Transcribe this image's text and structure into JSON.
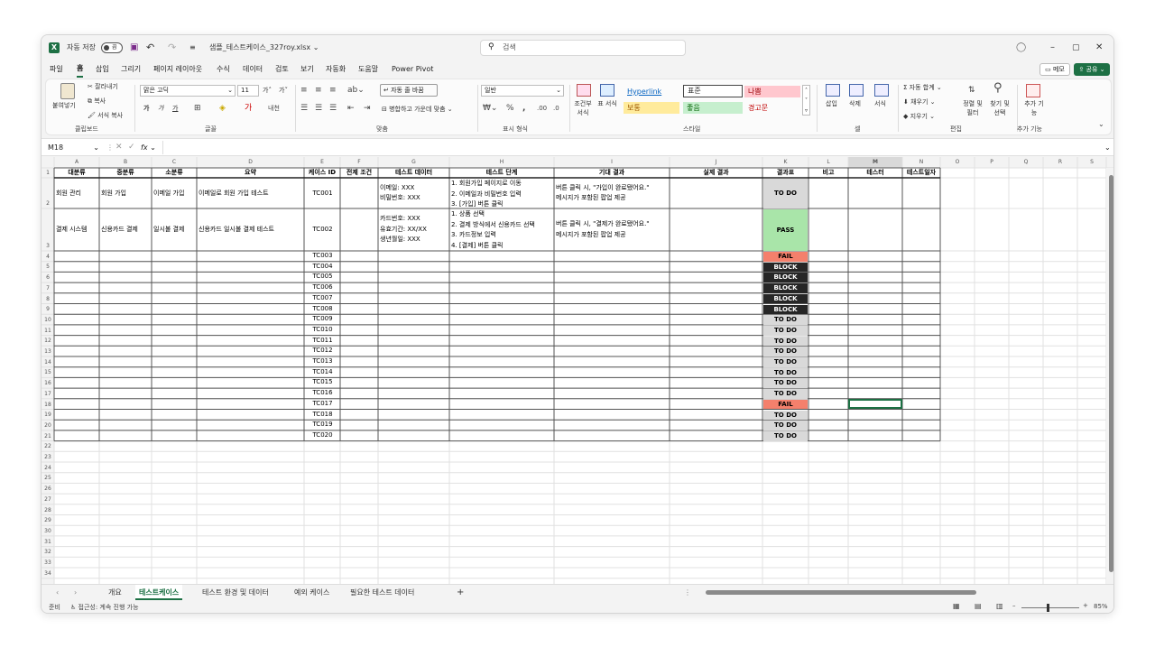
{
  "titlebar": {
    "autosave_label": "자동 저장",
    "autosave_state": "끔",
    "filename": "샘플_테스트케이스_327roy.xlsx",
    "search_placeholder": "검색"
  },
  "menu": [
    "파일",
    "홈",
    "삽입",
    "그리기",
    "페이지 레이아웃",
    "수식",
    "데이터",
    "검토",
    "보기",
    "자동화",
    "도움말",
    "Power Pivot"
  ],
  "menu_right": {
    "memo": "메모",
    "share": "공유"
  },
  "ribbon": {
    "clipboard": {
      "paste": "붙여넣기",
      "cut": "잘라내기",
      "copy": "복사",
      "format_painter": "서식 복사",
      "label": "클립보드"
    },
    "font": {
      "name": "맑은 고딕",
      "size": "11",
      "bold": "가",
      "italic": "가",
      "underline": "가",
      "label": "글꼴"
    },
    "align": {
      "wrap": "자동 줄 바꿈",
      "merge": "병합하고 가운데 맞춤",
      "label": "맞춤"
    },
    "number": {
      "format": "일반",
      "label": "표시 형식"
    },
    "styles": {
      "cond": "조건부 서식",
      "table": "표 서식",
      "hyperlink": "Hyperlink",
      "normal": "표준",
      "bad": "나쁨",
      "neutral": "보통",
      "good": "좋음",
      "warning": "경고문",
      "label": "스타일"
    },
    "cells": {
      "insert": "삽입",
      "delete": "삭제",
      "format": "서식",
      "label": "셀"
    },
    "edit": {
      "autosum": "자동 합계",
      "fill": "채우기",
      "clear": "지우기",
      "sort": "정렬 및 필터",
      "find": "찾기 및 선택",
      "label": "편집"
    },
    "addins": {
      "addin": "추가 기능",
      "label": "추가 기능"
    }
  },
  "formula_bar": {
    "name_box": "M18",
    "fx": "fx",
    "value": ""
  },
  "columns": [
    {
      "letter": "A",
      "header": "대분류"
    },
    {
      "letter": "B",
      "header": "중분류"
    },
    {
      "letter": "C",
      "header": "소분류"
    },
    {
      "letter": "D",
      "header": "요약"
    },
    {
      "letter": "E",
      "header": "케이스 ID"
    },
    {
      "letter": "F",
      "header": "전제 조건"
    },
    {
      "letter": "G",
      "header": "테스트 데이터"
    },
    {
      "letter": "H",
      "header": "테스트 단계"
    },
    {
      "letter": "I",
      "header": "기대 결과"
    },
    {
      "letter": "J",
      "header": "실제 결과"
    },
    {
      "letter": "K",
      "header": "결과표"
    },
    {
      "letter": "L",
      "header": "비고"
    },
    {
      "letter": "M",
      "header": "테스터"
    },
    {
      "letter": "N",
      "header": "테스트일자"
    },
    {
      "letter": "O",
      "header": ""
    },
    {
      "letter": "P",
      "header": ""
    },
    {
      "letter": "Q",
      "header": ""
    },
    {
      "letter": "R",
      "header": ""
    },
    {
      "letter": "S",
      "header": ""
    }
  ],
  "rows": [
    {
      "num": "2",
      "A": "회원 관리",
      "B": "회원 가입",
      "C": "이메일 가입",
      "D": "이메일로 회원 가입 테스트",
      "E": "TC001",
      "G": [
        "이메일: XXX",
        "비밀번호: XXX"
      ],
      "H": [
        "1. 회원가입 페이지로 이동",
        "2. 이메일과 비밀번호 입력",
        "3. [가입] 버튼 클릭"
      ],
      "I": [
        "버튼 클릭 시, \"가입이 완료됐어요.\"",
        "메시지가 포함된 팝업 제공"
      ],
      "K": "TO DO"
    },
    {
      "num": "3",
      "A": "결제 시스템",
      "B": "신용카드 결제",
      "C": "일시불 결제",
      "D": "신용카드 일시불 결제 테스트",
      "E": "TC002",
      "G": [
        "카드번호: XXX",
        "유효기간: XX/XX",
        "생년월일: XXX"
      ],
      "H": [
        "1. 상품 선택",
        "2. 결제 방식에서 신용카드 선택",
        "3. 카드정보 입력",
        "4. [결제] 버튼 클릭"
      ],
      "I": [
        "버튼 클릭 시, \"결제가 완료됐어요.\"",
        "메시지가 포함된 팝업 제공"
      ],
      "K": "PASS"
    },
    {
      "num": "4",
      "E": "TC003",
      "K": "FAIL"
    },
    {
      "num": "5",
      "E": "TC004",
      "K": "BLOCK"
    },
    {
      "num": "6",
      "E": "TC005",
      "K": "BLOCK"
    },
    {
      "num": "7",
      "E": "TC006",
      "K": "BLOCK"
    },
    {
      "num": "8",
      "E": "TC007",
      "K": "BLOCK"
    },
    {
      "num": "9",
      "E": "TC008",
      "K": "BLOCK"
    },
    {
      "num": "10",
      "E": "TC009",
      "K": "TO DO"
    },
    {
      "num": "11",
      "E": "TC010",
      "K": "TO DO"
    },
    {
      "num": "12",
      "E": "TC011",
      "K": "TO DO"
    },
    {
      "num": "13",
      "E": "TC012",
      "K": "TO DO"
    },
    {
      "num": "14",
      "E": "TC013",
      "K": "TO DO"
    },
    {
      "num": "15",
      "E": "TC014",
      "K": "TO DO"
    },
    {
      "num": "16",
      "E": "TC015",
      "K": "TO DO"
    },
    {
      "num": "17",
      "E": "TC016",
      "K": "TO DO"
    },
    {
      "num": "18",
      "E": "TC017",
      "K": "FAIL"
    },
    {
      "num": "19",
      "E": "TC018",
      "K": "TO DO"
    },
    {
      "num": "20",
      "E": "TC019",
      "K": "TO DO"
    },
    {
      "num": "21",
      "E": "TC020",
      "K": "TO DO"
    }
  ],
  "empty_rows": [
    "22",
    "23",
    "24",
    "25",
    "26",
    "27",
    "28",
    "29",
    "30",
    "31",
    "32",
    "33",
    "34"
  ],
  "status_colors": {
    "TO DO": "#d9d9d9",
    "PASS": "#a9e5a9",
    "FAIL": "#f4806c",
    "BLOCK": "#262626"
  },
  "sheet_tabs": [
    "개요",
    "테스트케이스",
    "테스트 환경 및 데이터",
    "예외 케이스",
    "필요한 테스트 데이터"
  ],
  "active_tab": "테스트케이스",
  "status": {
    "ready": "준비",
    "accessibility": "접근성: 계속 진행 가능",
    "zoom": "85%"
  }
}
